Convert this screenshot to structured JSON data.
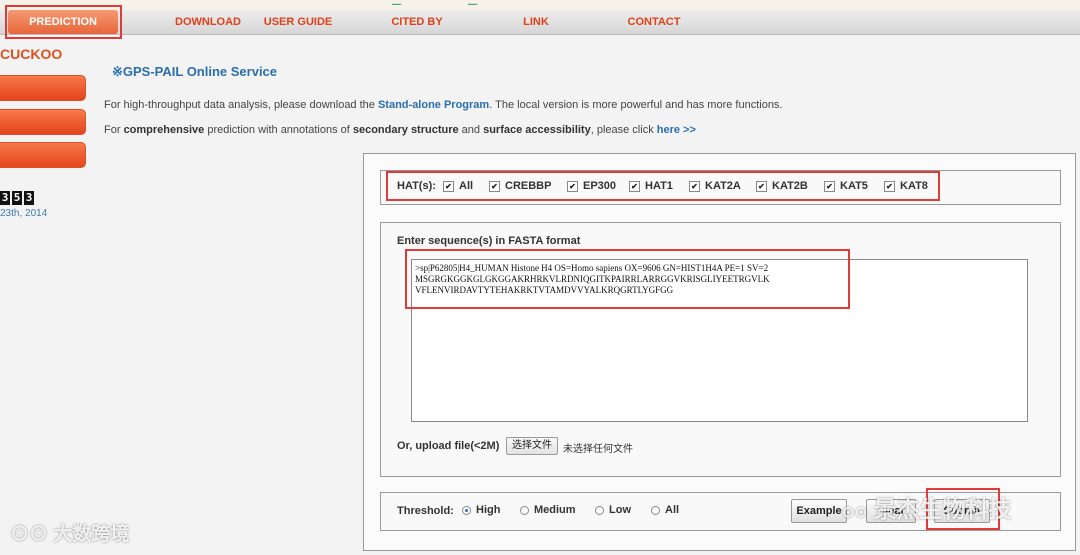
{
  "nav": {
    "items": [
      "PREDICTION",
      "DOWNLOAD",
      "USER GUIDE",
      "CITED BY",
      "LINK",
      "CONTACT"
    ],
    "active": "PREDICTION"
  },
  "sidebar": {
    "brand": "CUCKOO",
    "counter_digits": [
      "3",
      "5",
      "3"
    ],
    "date": "23th, 2014"
  },
  "service": {
    "title": "※GPS-PAIL Online Service",
    "line1_pre": "For high-throughput data analysis, please download the ",
    "line1_link": "Stand-alone Program",
    "line1_post": ". The local version is more powerful and has more functions.",
    "line2_pre": "For ",
    "line2_b1": "comprehensive",
    "line2_mid1": " prediction with annotations of ",
    "line2_b2": "secondary structure",
    "line2_mid2": " and ",
    "line2_b3": "surface accessibility",
    "line2_mid3": ", please click ",
    "line2_link": "here >>"
  },
  "hat": {
    "label": "HAT(s):",
    "options": [
      {
        "label": "All",
        "checked": true
      },
      {
        "label": "CREBBP",
        "checked": true
      },
      {
        "label": "EP300",
        "checked": true
      },
      {
        "label": "HAT1",
        "checked": true
      },
      {
        "label": "KAT2A",
        "checked": true
      },
      {
        "label": "KAT2B",
        "checked": true
      },
      {
        "label": "KAT5",
        "checked": true
      },
      {
        "label": "KAT8",
        "checked": true
      }
    ]
  },
  "sequence": {
    "label": "Enter sequence(s) in FASTA format",
    "value": ">sp|P62805|H4_HUMAN Histone H4 OS=Homo sapiens OX=9606 GN=HIST1H4A PE=1 SV=2\nMSGRGKGGKGLGKGGAKRHRKVLRDNIQGITKPAIRRLARRGGVKRISGLIYEETRGVLK\nVFLENVIRDAVTYTEHAKRKTVTAMDVVYALKRQGRTLYGFGG"
  },
  "upload": {
    "label": "Or, upload file(<2M)",
    "button": "选择文件",
    "status": "未选择任何文件"
  },
  "threshold": {
    "label": "Threshold:",
    "options": [
      "High",
      "Medium",
      "Low",
      "All"
    ],
    "selected": "High"
  },
  "buttons": {
    "example": "Example",
    "clear": "Clear",
    "submit": "Submit"
  },
  "watermarks": {
    "left": "大数跨境",
    "right": "景杰生物科技"
  },
  "colors": {
    "nav_text": "#e0401a",
    "highlight": "#e23a3a",
    "link": "#2a6fad"
  }
}
